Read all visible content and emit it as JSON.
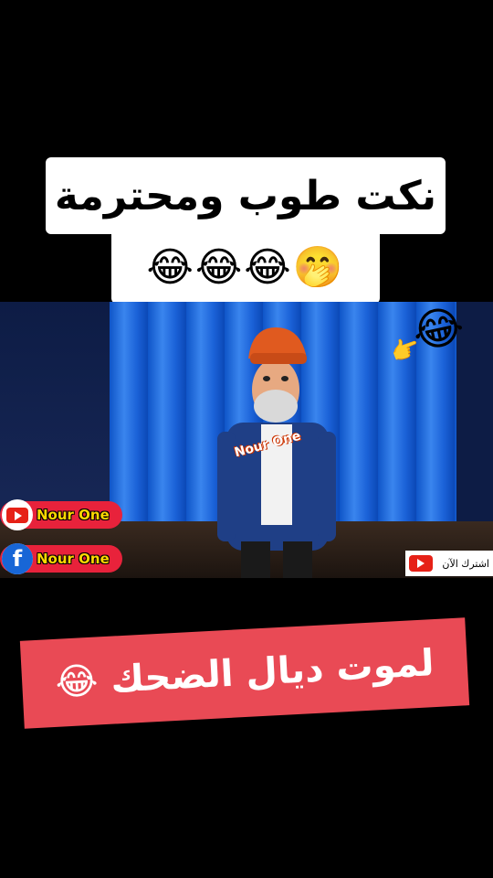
{
  "title": {
    "text": "نكت طوب ومحترمة",
    "emojis": "😂😂😂🤭"
  },
  "video": {
    "watermark": "Nour One",
    "youtube_badge": {
      "label": "Nour One",
      "icon": "youtube-icon"
    },
    "facebook_badge": {
      "label": "Nour One",
      "icon": "facebook-icon",
      "glyph": "f"
    },
    "subscribe": {
      "label": "اشترك الآن",
      "icon": "youtube-icon"
    },
    "laugh_emoji": "😂",
    "point_emoji": "👉"
  },
  "banner": {
    "text": "لموت ديال الضحك 😂"
  },
  "colors": {
    "banner_bg": "#e94a55",
    "badge_bg": "#e8223b",
    "badge_text": "#ffd800",
    "curtain": "#1b62d8"
  }
}
